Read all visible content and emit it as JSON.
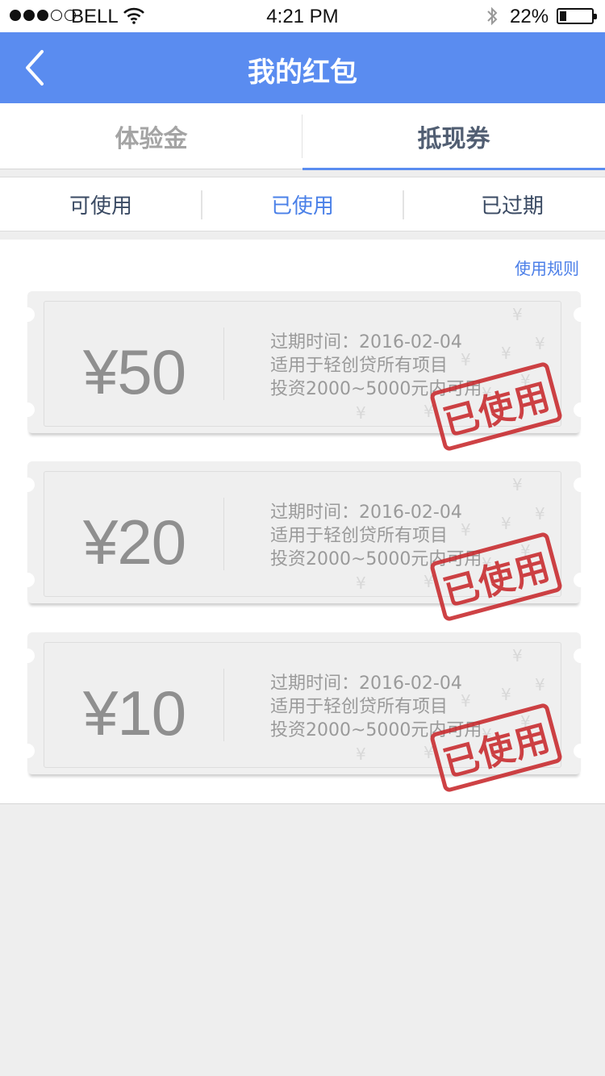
{
  "status_bar": {
    "carrier": "BELL",
    "time": "4:21 PM",
    "battery": "22%",
    "battery_level": 0.22
  },
  "nav": {
    "title": "我的红包",
    "back_icon": "chevron-left-icon",
    "background": "#5a8cf0"
  },
  "top_tabs": [
    {
      "label": "体验金",
      "active": false
    },
    {
      "label": "抵现券",
      "active": true
    }
  ],
  "sub_tabs": [
    {
      "label": "可使用",
      "active": false
    },
    {
      "label": "已使用",
      "active": true
    },
    {
      "label": "已过期",
      "active": false
    }
  ],
  "rules_link": "使用规则",
  "coupons": [
    {
      "amount": "¥50",
      "expiry": "过期时间：2016-02-04",
      "scope": "适用于轻创贷所有项目",
      "condition": "投资2000~5000元内可用",
      "stamp": "已使用"
    },
    {
      "amount": "¥20",
      "expiry": "过期时间：2016-02-04",
      "scope": "适用于轻创贷所有项目",
      "condition": "投资2000~5000元内可用",
      "stamp": "已使用"
    },
    {
      "amount": "¥10",
      "expiry": "过期时间：2016-02-04",
      "scope": "适用于轻创贷所有项目",
      "condition": "投资2000~5000元内可用",
      "stamp": "已使用"
    }
  ],
  "colors": {
    "accent": "#5a8cf0",
    "link": "#4a7ee8",
    "stamp": "#c8282c"
  }
}
